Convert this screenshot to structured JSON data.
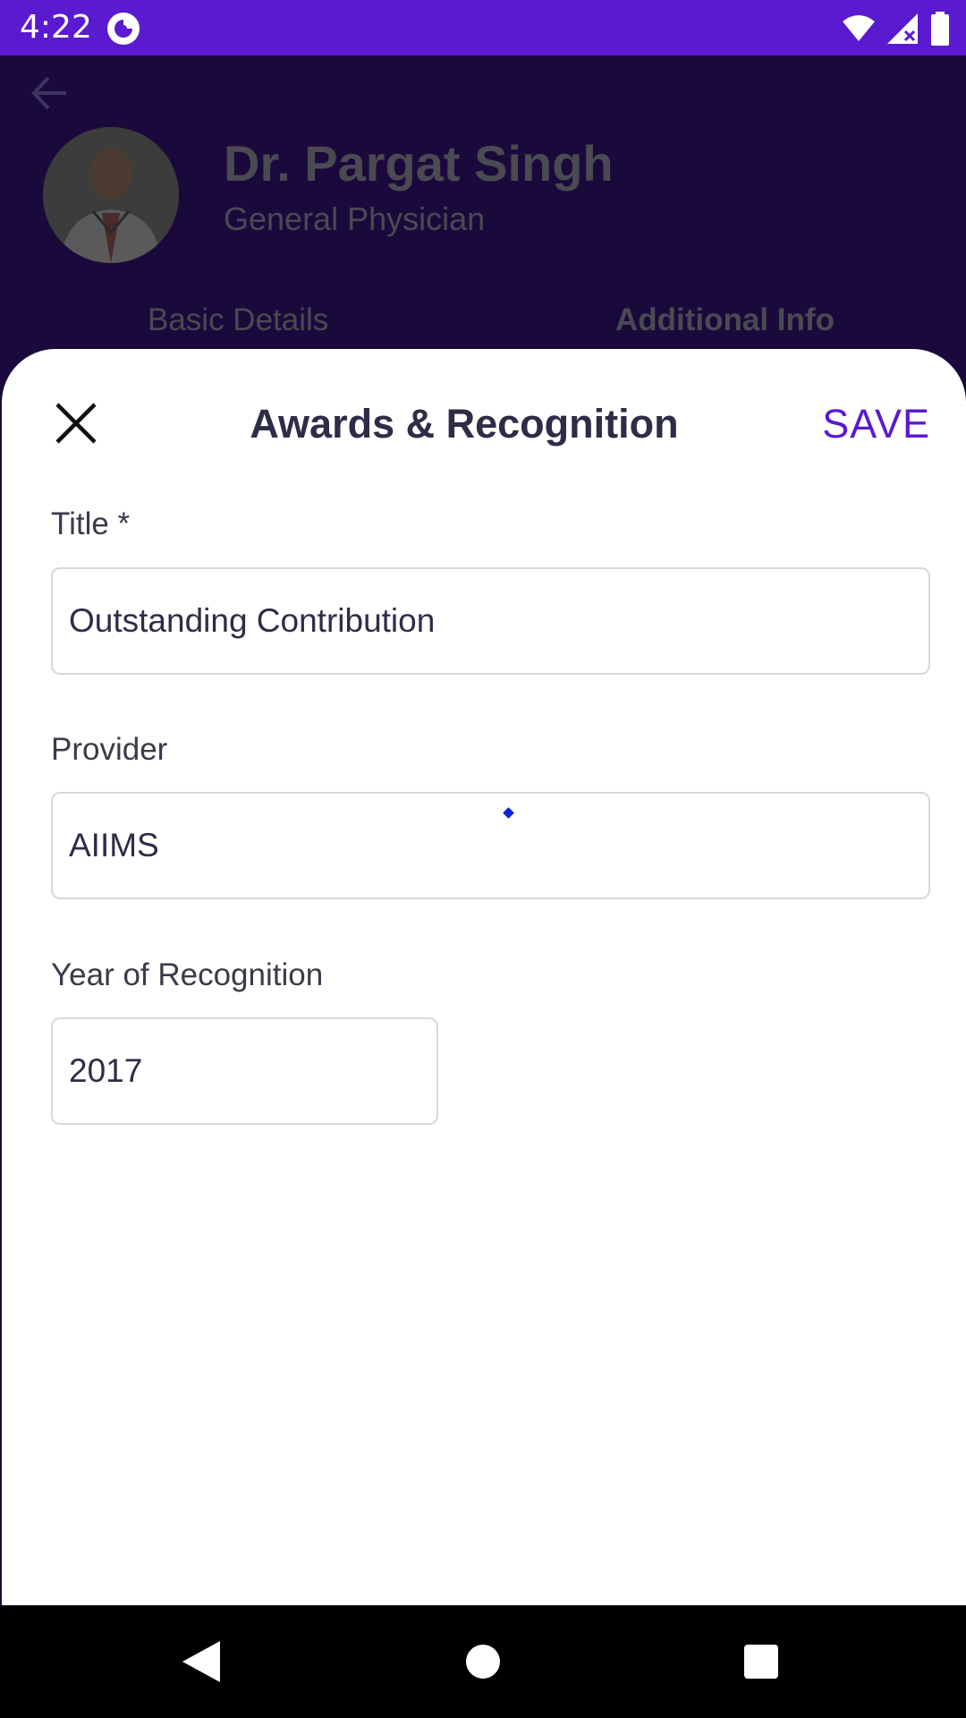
{
  "status_bar": {
    "time": "4:22",
    "icons": [
      "app-notification-icon",
      "wifi-icon",
      "signal-icon",
      "battery-icon"
    ]
  },
  "profile": {
    "name": "Dr. Pargat Singh",
    "specialty": "General Physician",
    "tabs": [
      {
        "label": "Basic Details",
        "selected": false
      },
      {
        "label": "Additional Info",
        "selected": true
      }
    ]
  },
  "sheet": {
    "title": "Awards & Recognition",
    "save_label": "SAVE",
    "fields": {
      "title": {
        "label": "Title *",
        "value": "Outstanding Contribution"
      },
      "provider": {
        "label": "Provider",
        "value": "AIIMS"
      },
      "year": {
        "label": "Year of Recognition",
        "value": "2017"
      }
    }
  },
  "colors": {
    "accent": "#5a1ad0",
    "overlay": "#1a0a3c",
    "title_text": "#2e2d48",
    "field_border": "#d8d8d8"
  }
}
